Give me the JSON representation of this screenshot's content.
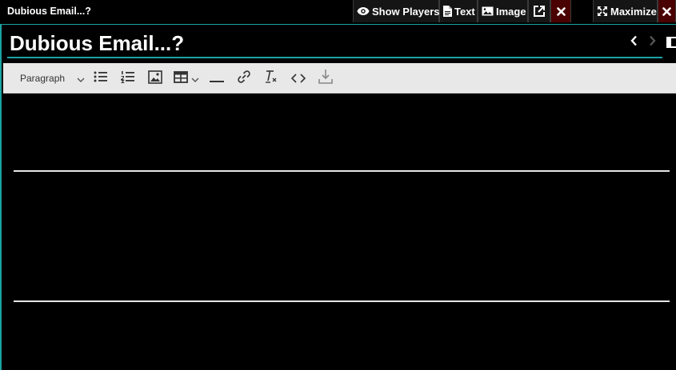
{
  "window": {
    "title": "Dubious Email...?"
  },
  "header": {
    "show_players_label": "Show Players",
    "text_label": "Text",
    "image_label": "Image",
    "maximize_label": "Maximize"
  },
  "sheet": {
    "title_value": "Dubious Email...?"
  },
  "toolbar": {
    "paragraph_label": "Paragraph"
  },
  "colors": {
    "accent": "#1aa3a3",
    "close_bg": "#4a0000",
    "toolbar_bg": "#e8e8e8",
    "editor_bg": "#000000"
  }
}
